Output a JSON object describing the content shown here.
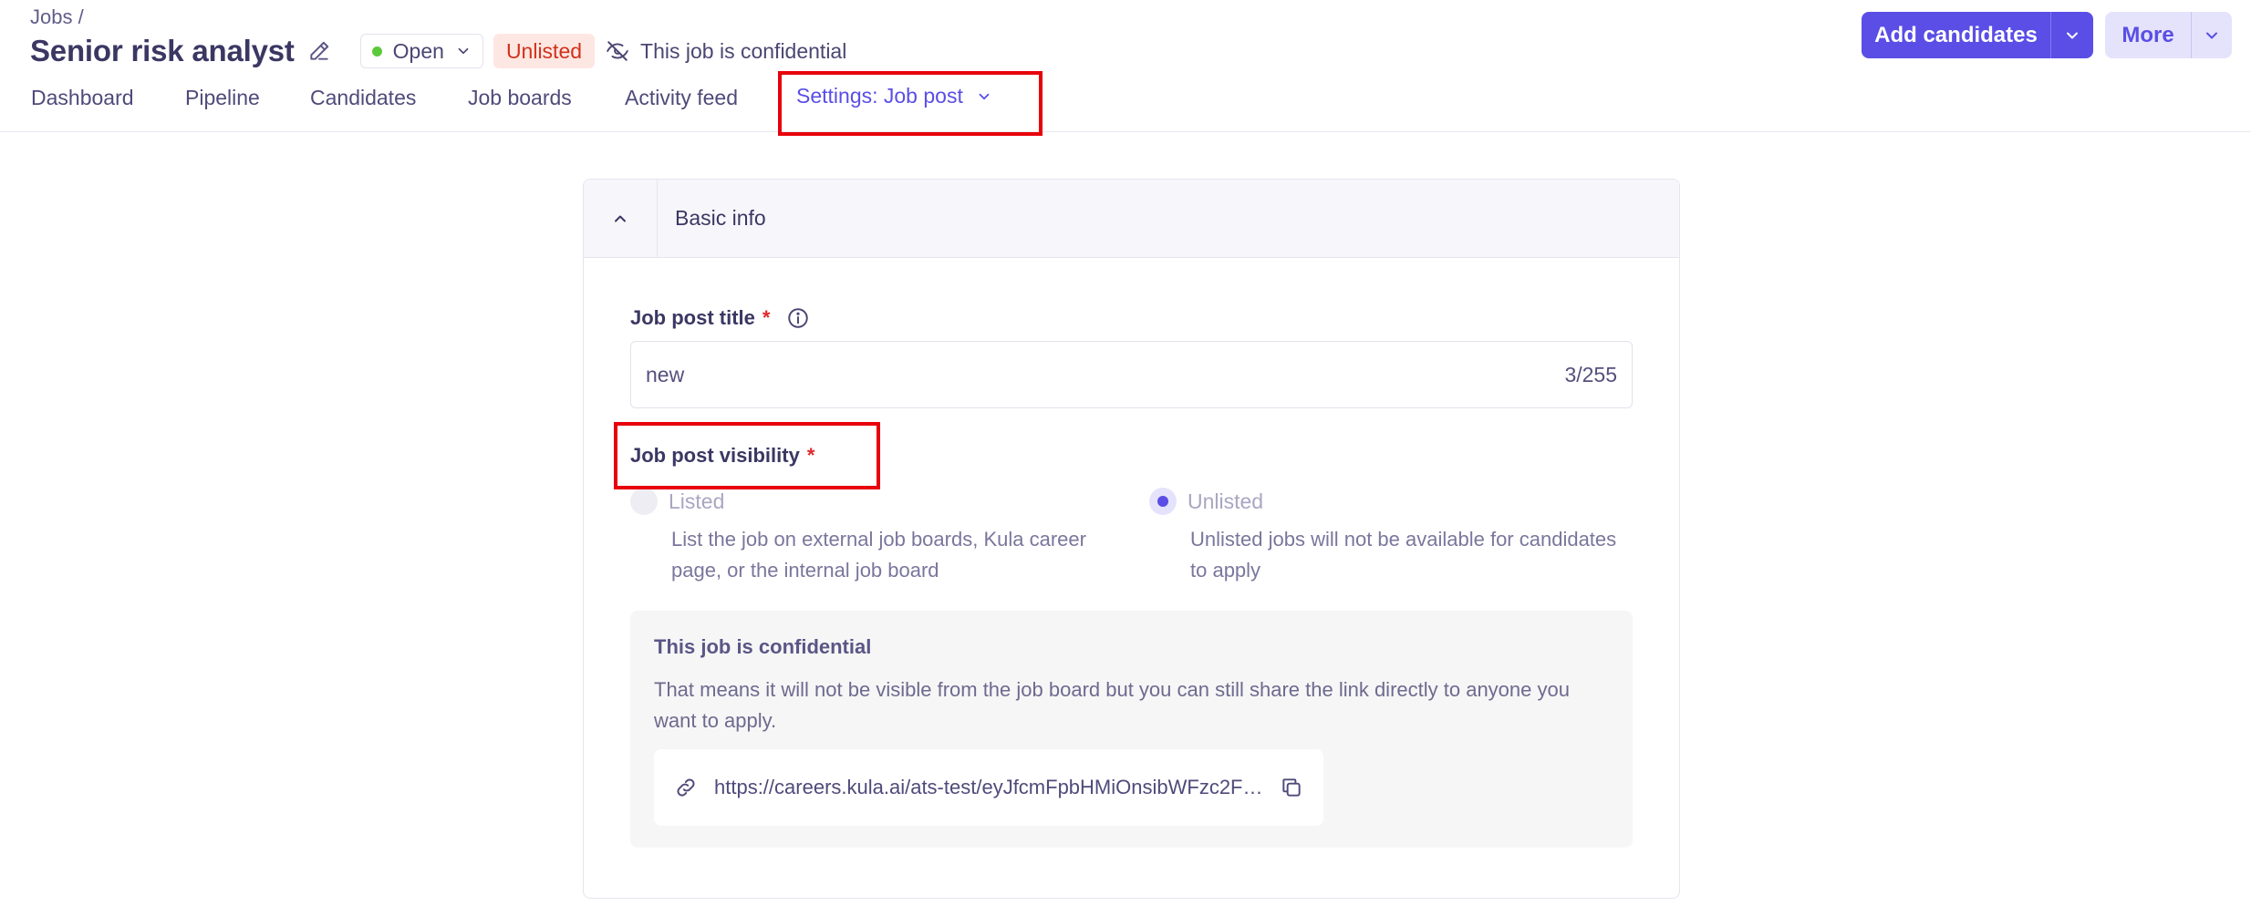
{
  "header": {
    "breadcrumb": "Jobs /",
    "title": "Senior risk analyst",
    "status": "Open",
    "visibility_badge": "Unlisted",
    "confidential_text": "This job is confidential",
    "add_candidates_label": "Add candidates",
    "more_label": "More"
  },
  "tabs": [
    {
      "label": "Dashboard"
    },
    {
      "label": "Pipeline"
    },
    {
      "label": "Candidates"
    },
    {
      "label": "Job boards"
    },
    {
      "label": "Activity feed"
    },
    {
      "label": "Settings: Job post",
      "active": true
    }
  ],
  "section": {
    "title": "Basic info",
    "title_field": {
      "label": "Job post title",
      "required_mark": "*",
      "value": "new",
      "counter": "3/255"
    },
    "visibility_field": {
      "label": "Job post visibility",
      "required_mark": "*",
      "options": [
        {
          "label": "Listed",
          "description": "List the job on external job boards, Kula career page, or the internal job board",
          "selected": false
        },
        {
          "label": "Unlisted",
          "description": "Unlisted jobs will not be available for candidates to apply",
          "selected": true
        }
      ]
    },
    "confidential": {
      "title": "This job is confidential",
      "text": "That means it will not be visible from the job board but you can still share the link directly to anyone you want to apply.",
      "link": "https://careers.kula.ai/ats-test/eyJfcmFpbHMiOnsibWFzc2FnZSI6IkJBaHBBNmc9IiwiZXhwIjpudWxsLCJwdXIiOm51bGx9fQ"
    }
  },
  "colors": {
    "accent": "#5a4ee6",
    "highlight": "#e8000b",
    "status_open": "#5cc93b",
    "unlisted_badge_text": "#d0321a"
  },
  "icons": [
    "pencil-icon",
    "chevron-down-icon",
    "eye-off-icon",
    "chevron-up-icon",
    "info-icon",
    "link-icon",
    "copy-icon"
  ]
}
